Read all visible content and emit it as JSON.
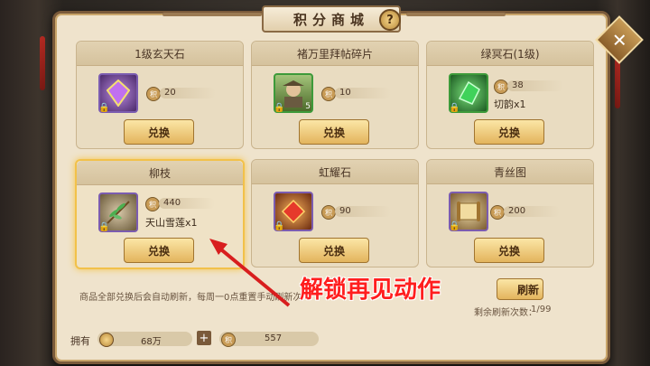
{
  "window": {
    "title": "积分商城",
    "help": "?",
    "close": "✕"
  },
  "items": [
    {
      "name": "1级玄天石",
      "price": "20",
      "extra": "",
      "count": "",
      "button": "兑换",
      "price_icon": "积"
    },
    {
      "name": "褚万里拜帖碎片",
      "price": "10",
      "extra": "",
      "count": "5",
      "button": "兑换",
      "price_icon": "积"
    },
    {
      "name": "绿冥石(1级)",
      "price": "38",
      "extra": "切韵x1",
      "count": "",
      "button": "兑换",
      "price_icon": "积"
    },
    {
      "name": "柳枝",
      "price": "440",
      "extra": "天山雪莲x1",
      "count": "",
      "button": "兑换",
      "price_icon": "积"
    },
    {
      "name": "虹耀石",
      "price": "90",
      "extra": "",
      "count": "",
      "button": "兑换",
      "price_icon": "积"
    },
    {
      "name": "青丝图",
      "price": "200",
      "extra": "",
      "count": "",
      "button": "兑换",
      "price_icon": "积"
    }
  ],
  "footer": {
    "info_text": "商品全部兑换后会自动刷新，每周一0点重置手动刷新次",
    "refresh_button": "刷新",
    "refresh_count_label": "剩余刷新次数：",
    "refresh_count_value": "1/99",
    "own_label": "拥有",
    "gold_value": "68万",
    "points_icon": "积",
    "points_value": "557",
    "plus": "+"
  },
  "annotation": {
    "text": "解锁再见动作",
    "color": "#ff1e1e"
  }
}
